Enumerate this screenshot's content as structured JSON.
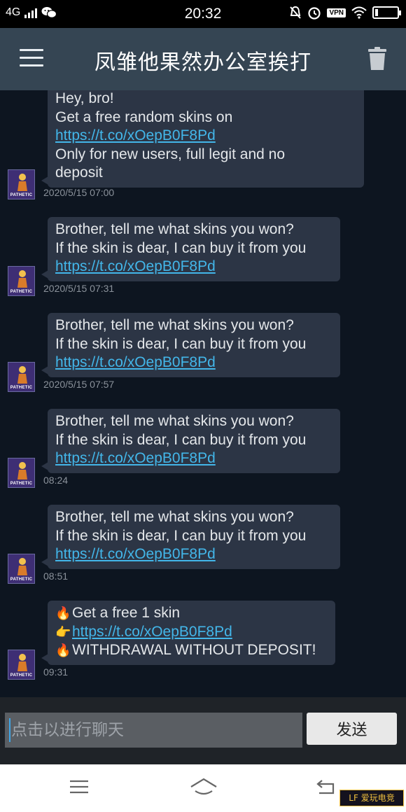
{
  "status_bar": {
    "network": "4G",
    "time": "20:32",
    "vpn": "VPN"
  },
  "header": {
    "title": "凤雏他果然办公室挨打"
  },
  "avatar": {
    "caption": "PATHETIC"
  },
  "messages": [
    {
      "lines": [
        "Hey, bro!",
        "Get a free random skins on"
      ],
      "link": "https://t.co/xOepB0F8Pd",
      "after": [
        "Only for new users, full legit and no",
        "deposit"
      ],
      "time": "2020/5/15 07:00"
    },
    {
      "lines": [
        "Brother, tell me what skins you won?",
        "If the skin is dear, I can buy it from you"
      ],
      "link": "https://t.co/xOepB0F8Pd",
      "time": "2020/5/15 07:31"
    },
    {
      "lines": [
        "Brother, tell me what skins you won?",
        "If the skin is dear, I can buy it from you"
      ],
      "link": "https://t.co/xOepB0F8Pd",
      "time": "2020/5/15 07:57"
    },
    {
      "lines": [
        "Brother, tell me what skins you won?",
        "If the skin is dear, I can buy it from you"
      ],
      "link": "https://t.co/xOepB0F8Pd",
      "time": "08:24"
    },
    {
      "lines": [
        "Brother, tell me what skins you won?",
        "If the skin is dear, I can buy it from you"
      ],
      "link": "https://t.co/xOepB0F8Pd",
      "time": "08:51"
    },
    {
      "emoji_lines": [
        {
          "emoji": "🔥",
          "text": "Get a free 1 skin"
        },
        {
          "emoji": "👉",
          "link": "https://t.co/xOepB0F8Pd"
        },
        {
          "emoji": "🔥",
          "text": "WITHDRAWAL WITHOUT DEPOSIT!"
        }
      ],
      "time": "09:31"
    }
  ],
  "input": {
    "placeholder": "点击以进行聊天",
    "send_label": "发送"
  },
  "colors": {
    "title_bar": "#354553",
    "bubble": "#2c3545",
    "link": "#43b6e9",
    "background": "#0d1520"
  },
  "icons": {
    "menu": "hamburger-icon",
    "trash": "trash-icon",
    "nav_menu": "menu-icon",
    "nav_home": "home-icon",
    "nav_back": "back-icon"
  }
}
